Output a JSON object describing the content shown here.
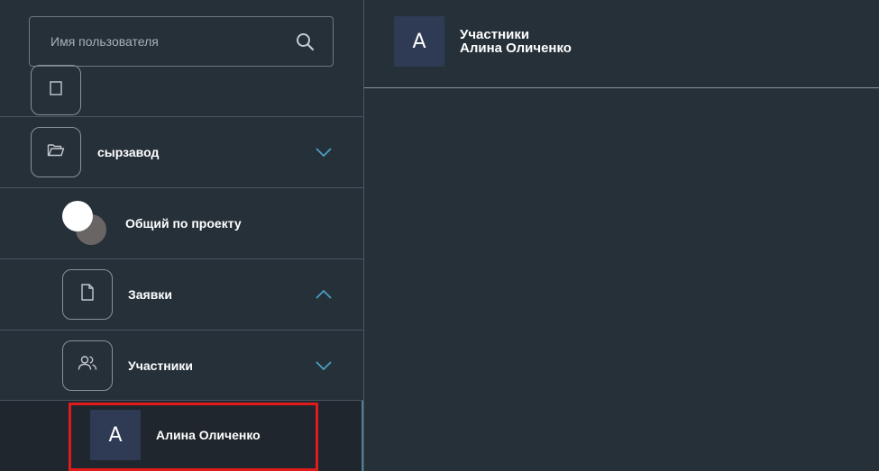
{
  "search": {
    "placeholder": "Имя пользователя",
    "icon": "search-icon"
  },
  "tree": {
    "folder": {
      "label": "сырзавод",
      "icon": "folder-icon",
      "expanded": false
    },
    "general": {
      "label": "Общий по проекту"
    },
    "requests": {
      "label": "Заявки",
      "icon": "file-icon",
      "expanded": true
    },
    "members": {
      "label": "Участники",
      "icon": "users-icon",
      "expanded": false
    },
    "selected_user": {
      "avatar_letter": "А",
      "name": "Алина Оличенко"
    }
  },
  "header": {
    "avatar_letter": "А",
    "title": "Участники",
    "subtitle": "Алина Оличенко"
  },
  "colors": {
    "background": "#263039",
    "chevron": "#4a9fc4",
    "avatar_bg": "#2f3a55",
    "selection_border": "#e01b1b"
  }
}
